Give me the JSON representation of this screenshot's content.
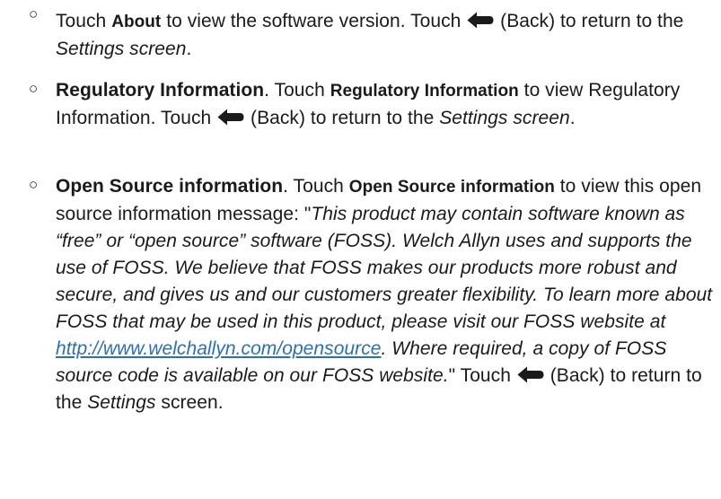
{
  "items": [
    {
      "bullet": "○",
      "p1": "Touch ",
      "about_label": "About",
      "p2": " to view the software version. Touch ",
      "p3": " (Back) to return to the ",
      "settings_screen": "Settings screen",
      "p4": "."
    },
    {
      "bullet": "○",
      "title": "Regulatory Information",
      "p1": ". Touch ",
      "touch_label": "Regulatory Information",
      "p2": " to view Regulatory Information. Touch ",
      "p3": " (Back) to return to the ",
      "settings_screen": "Settings screen",
      "p4": "."
    },
    {
      "bullet": "○",
      "title": "Open Source information",
      "p1": ". Touch ",
      "touch_label": "Open Source information",
      "p2": " to view this open source information message: \"",
      "quote1": "This product may contain software known as “free” or “open source” software (FOSS). Welch Allyn uses and supports the use of FOSS. We believe that FOSS makes our products more robust and secure, and gives us and our customers greater flexibility. To learn more about FOSS that may be used in this product, please visit our FOSS website at ",
      "link": "http://www.welchallyn.com/opensource",
      "quote2": ". Where required, a copy of FOSS source code is available on our FOSS website.",
      "p3": "\" Touch ",
      "p4": " (Back) to return to the ",
      "settings_label": "Settings",
      "p5": " screen."
    }
  ],
  "icons": {
    "back": "back-arrow-icon"
  }
}
